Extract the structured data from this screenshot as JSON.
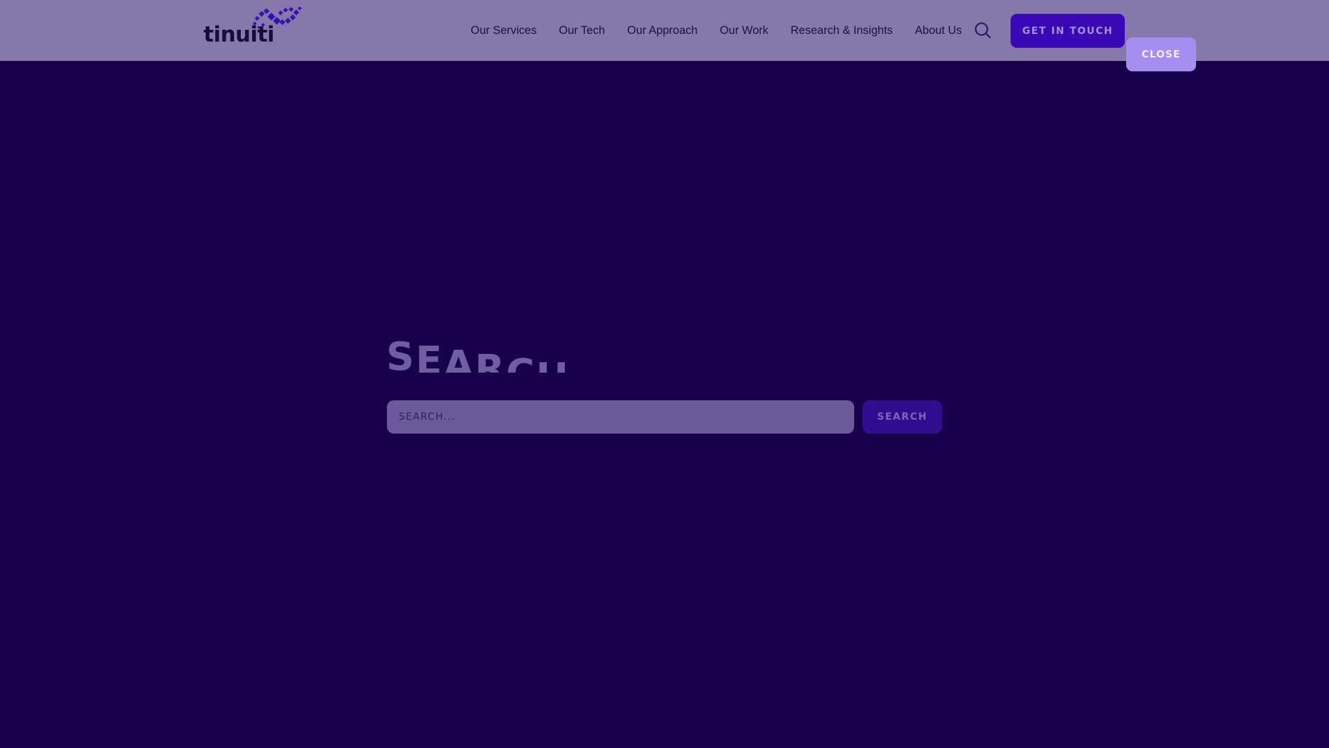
{
  "brand": {
    "logo_text": "tinuiti",
    "accent_color": "#3b08b5"
  },
  "nav": {
    "items": [
      {
        "label": "Our Services"
      },
      {
        "label": "Our Tech"
      },
      {
        "label": "Our Approach"
      },
      {
        "label": "Our Work"
      },
      {
        "label": "Research & Insights"
      },
      {
        "label": "About Us"
      }
    ],
    "search_icon": "search-icon"
  },
  "header": {
    "cta_label": "GET IN TOUCH",
    "close_label": "CLOSE"
  },
  "search_overlay": {
    "heading": "SEARCH",
    "input_value": "",
    "placeholder": "SEARCH...",
    "submit_label": "SEARCH"
  },
  "colors": {
    "overlay_background": "#19004a",
    "header_background": "#8778ac",
    "close_button": "#a68ef1"
  }
}
